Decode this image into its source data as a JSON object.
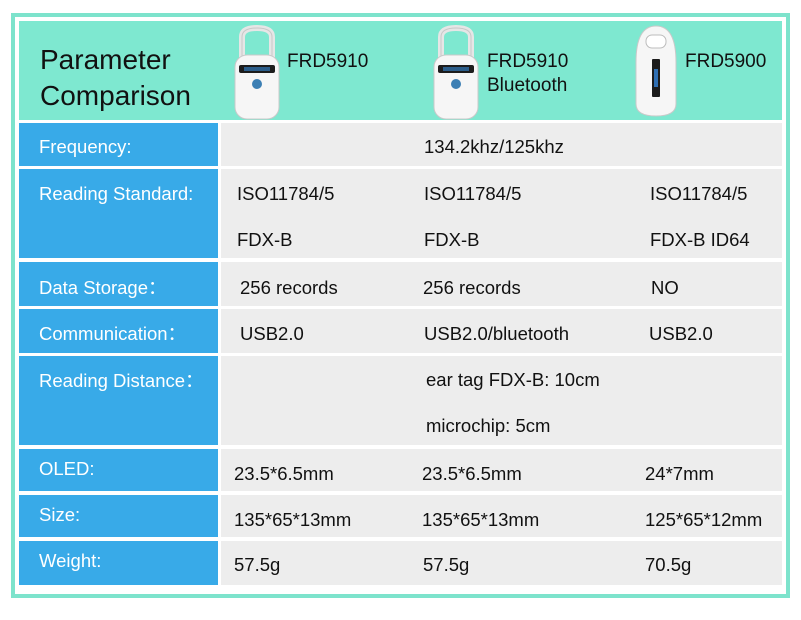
{
  "header": {
    "title_line1": "Parameter",
    "title_line2": "Comparison",
    "products": [
      {
        "name_line1": "FRD5910",
        "name_line2": "",
        "image": "reader-device-icon"
      },
      {
        "name_line1": "FRD5910",
        "name_line2": "Bluetooth",
        "image": "reader-device-icon"
      },
      {
        "name_line1": "FRD5900",
        "name_line2": "",
        "image": "reader-device-icon"
      }
    ]
  },
  "rows": {
    "frequency": {
      "label": "Frequency:",
      "value": "134.2khz/125khz"
    },
    "reading_standard": {
      "label": "Reading Standard:",
      "values": [
        [
          "ISO11784/5",
          "FDX-B"
        ],
        [
          "ISO11784/5",
          "FDX-B"
        ],
        [
          "ISO11784/5",
          "FDX-B ID64"
        ]
      ]
    },
    "data_storage": {
      "label": "Data Storage：",
      "values": [
        "256 records",
        "256 records",
        "NO"
      ]
    },
    "communication": {
      "label": "Communication：",
      "values": [
        "USB2.0",
        "USB2.0/bluetooth",
        "USB2.0"
      ]
    },
    "reading_distance": {
      "label": "Reading Distance：",
      "line1": "ear tag FDX-B: 10cm",
      "line2": "microchip: 5cm"
    },
    "oled": {
      "label": "OLED:",
      "values": [
        "23.5*6.5mm",
        "23.5*6.5mm",
        "24*7mm"
      ]
    },
    "size": {
      "label": "Size:",
      "values": [
        "135*65*13mm",
        "135*65*13mm",
        "125*65*12mm"
      ]
    },
    "weight": {
      "label": "Weight:",
      "values": [
        "57.5g",
        "57.5g",
        "70.5g"
      ]
    }
  },
  "colors": {
    "header_bg": "#7ee8d0",
    "frame": "#7de3cc",
    "label_bg": "#38aae8",
    "cell_bg": "#ededed"
  }
}
